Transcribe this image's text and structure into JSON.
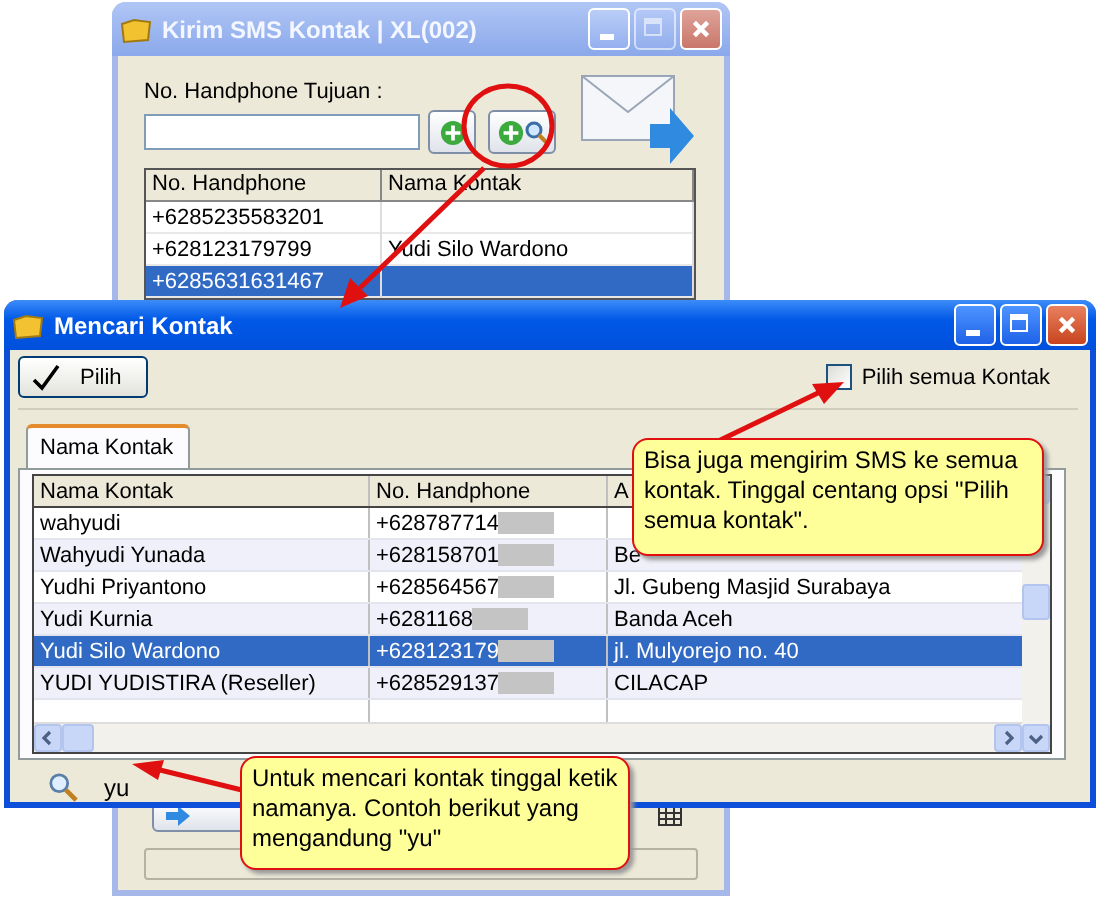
{
  "back_window": {
    "title": "Kirim SMS Kontak | XL(002)",
    "phone_label": "No. Handphone Tujuan :",
    "table": {
      "columns": [
        "No. Handphone",
        "Nama Kontak"
      ],
      "rows": [
        {
          "phone": "+6285235583201",
          "selected": false
        },
        {
          "phone": "+628123179799",
          "name": "Yudi Silo Wardono",
          "selected": false
        },
        {
          "phone": "+6285631631467",
          "selected": true
        }
      ]
    }
  },
  "dialog": {
    "title": "Mencari Kontak",
    "select_button": "Pilih",
    "select_all": {
      "label": "Pilih semua Kontak",
      "checked": false
    },
    "tabs": [
      {
        "label": "Nama Kontak",
        "selected": true
      }
    ],
    "table": {
      "columns": [
        "Nama Kontak",
        "No. Handphone",
        "A"
      ],
      "rows": [
        {
          "name": "wahyudi",
          "phone": "+628787714",
          "redacted": true,
          "selected": false
        },
        {
          "name": "Wahyudi Yunada",
          "phone": "+628158701",
          "redacted": true,
          "address": "Be",
          "selected": false
        },
        {
          "name": "Yudhi Priyantono",
          "phone": "+628564567",
          "redacted": true,
          "address": "Jl. Gubeng Masjid Surabaya",
          "selected": false
        },
        {
          "name": "Yudi Kurnia",
          "phone": "+6281168",
          "redacted": true,
          "address": "Banda Aceh",
          "selected": false
        },
        {
          "name": "Yudi Silo Wardono",
          "phone": "+628123179",
          "redacted": true,
          "address": "jl. Mulyorejo no. 40",
          "selected": true
        },
        {
          "name": "YUDI YUDISTIRA (Reseller)",
          "phone": "+628529137",
          "redacted": true,
          "address": "CILACAP",
          "selected": false
        }
      ]
    },
    "search": {
      "value": "yu"
    }
  },
  "callouts": [
    {
      "text": "Bisa juga mengirim SMS ke semua kontak. Tinggal centang opsi \"Pilih semua kontak\"."
    },
    {
      "text": "Untuk mencari kontak tinggal ketik namanya. Contoh berikut yang mengandung \"yu\""
    }
  ]
}
